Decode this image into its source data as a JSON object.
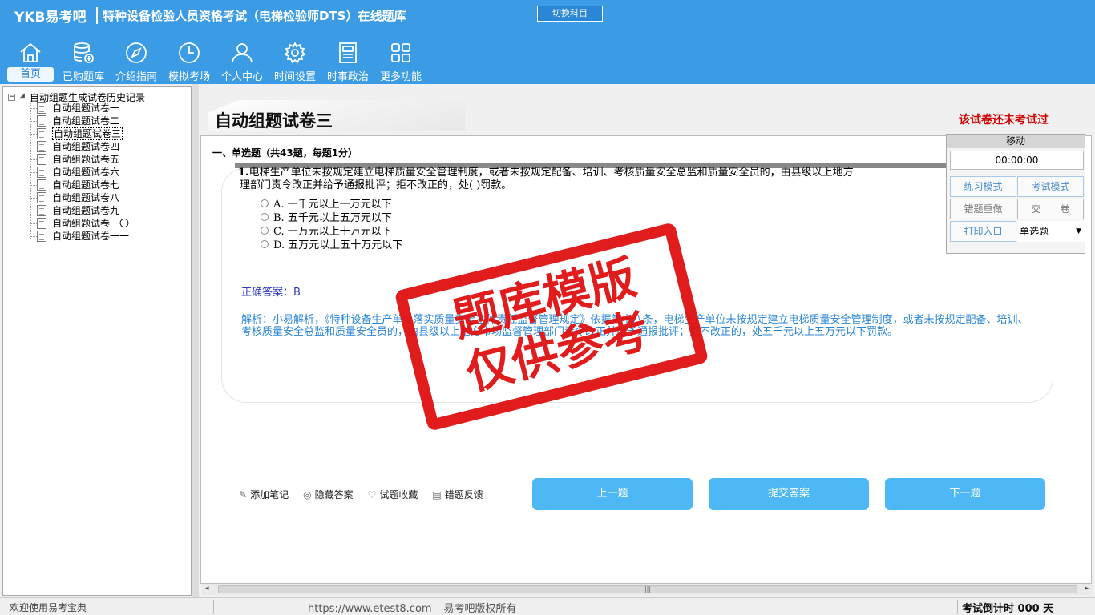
{
  "header": {
    "logo": "YKB易考吧",
    "title": "特种设备检验人员资格考试（电梯检验师DTS）在线题库",
    "switch_button": "切换科目"
  },
  "nav": [
    {
      "label": "首页",
      "icon": "home-icon"
    },
    {
      "label": "已购题库",
      "icon": "database-icon"
    },
    {
      "label": "介绍指南",
      "icon": "compass-icon"
    },
    {
      "label": "模拟考场",
      "icon": "clock-icon"
    },
    {
      "label": "个人中心",
      "icon": "user-icon"
    },
    {
      "label": "时间设置",
      "icon": "gear-icon"
    },
    {
      "label": "时事政治",
      "icon": "news-icon"
    },
    {
      "label": "更多功能",
      "icon": "grid-icon"
    }
  ],
  "tree": {
    "root": "自动组题生成试卷历史记录",
    "items": [
      "自动组题试卷一",
      "自动组题试卷二",
      "自动组题试卷三",
      "自动组题试卷四",
      "自动组题试卷五",
      "自动组题试卷六",
      "自动组题试卷七",
      "自动组题试卷八",
      "自动组题试卷九",
      "自动组题试卷一〇",
      "自动组题试卷一一"
    ]
  },
  "main": {
    "paper_title": "自动组题试卷三",
    "status": "该试卷还未考试过",
    "section": "一、单选题（共43题，每题1分）",
    "question": {
      "number": "1.",
      "text": "电梯生产单位未按规定建立电梯质量安全管理制度，或者未按规定配备、培训、考核质量安全总监和质量安全员的，由县级以上地方",
      "text2": "理部门责令改正并给予通报批评；拒不改正的，处(  )罚款。",
      "options": [
        "A. 一千元以上一万元以下",
        "B. 五千元以上五万元以下",
        "C. 一万元以上十万元以下",
        "D. 五万元以上五十万元以下"
      ]
    },
    "answer": "正确答案：B",
    "analysis": "解析：小易解析，《特种设备生产单位落实质量安全主体责任监督管理规定》依据第十八条，电梯生产单位未按规定建立电梯质量安全管理制度，或者未按规定配备、培训、考核质量安全总监和质量安全员的，由县级以上地方市场监督管理部门责令改正并给予通报批评；拒不改正的，处五千元以上五万元以下罚款。"
  },
  "tools": [
    {
      "label": "添加笔记",
      "icon": "pencil-icon"
    },
    {
      "label": "隐藏答案",
      "icon": "eye-icon"
    },
    {
      "label": "试题收藏",
      "icon": "heart-icon"
    },
    {
      "label": "错题反馈",
      "icon": "feedback-icon"
    }
  ],
  "buttons": {
    "prev": "上一题",
    "submit": "提交答案",
    "next": "下一题"
  },
  "panel": {
    "title": "移动",
    "timer": "00:00:00",
    "practice": "练习模式",
    "exam": "考试模式",
    "redo": "错题重做",
    "hand_in": "交　　卷",
    "print": "打印入口",
    "type_select": "单选题"
  },
  "stamp": {
    "line1": "题库模版",
    "line2": "仅供参考"
  },
  "statusbar": {
    "welcome": "欢迎使用易考宝典",
    "copyright": "https://www.etest8.com – 易考吧版权所有",
    "countdown": "考试倒计时 000 天"
  },
  "colors": {
    "header_bg": "#3b9be5",
    "button_bg": "#4db8f4",
    "stamp": "#e01010",
    "answer": "#2a38c0",
    "analysis": "#2a86d6",
    "status": "#cc0000"
  }
}
